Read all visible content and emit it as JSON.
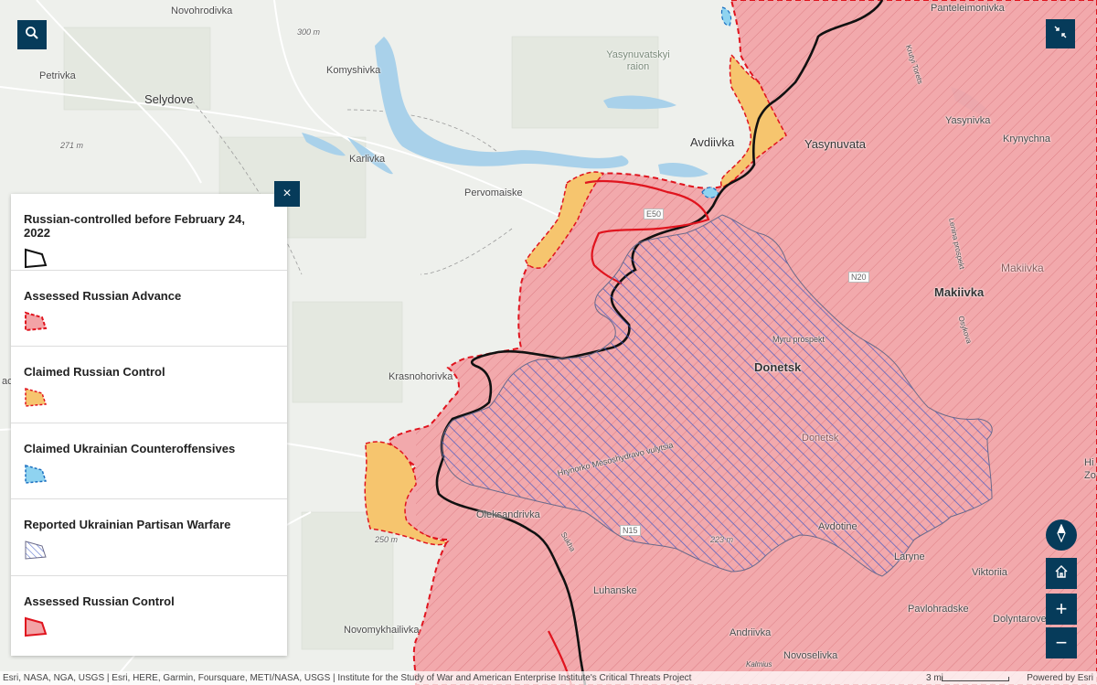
{
  "map": {
    "places": {
      "novohrodivka": "Novohrodivka",
      "petrivka": "Petrivka",
      "selydove": "Selydove",
      "komyshivka": "Komyshivka",
      "yasynuvatskyi_raion": "Yasynuvatskyi raion",
      "avdiivka": "Avdiivka",
      "karlivka": "Karlivka",
      "pervomaiske": "Pervomaiske",
      "panteleimonivka": "Panteleimonivka",
      "yasynivka": "Yasynivka",
      "yasynuvata": "Yasynuvata",
      "krynychna": "Krynychna",
      "makiivka_big": "Makiivka",
      "makiivka_small": "Makiivka",
      "donetsk": "Donetsk",
      "donetsk_small": "Donetsk",
      "krasnohorivka": "Krasnohorivka",
      "oleksandrivka": "Oleksandrivka",
      "avdotine": "Avdotine",
      "laryne": "Laryne",
      "viktoriia": "Viktoriia",
      "luhanske": "Luhanske",
      "pavlohradske": "Pavlohradske",
      "andriivka": "Andriivka",
      "dolyntarove": "Dolyntarove",
      "novomykhailivka": "Novomykhailivka",
      "novoselivka": "Novoselivka",
      "myru_prospekt": "Myru prospekt",
      "hrynorko": "Hrynorko Mesoshydravo vulytsia",
      "lenina": "Lenina prospekt",
      "krutyi": "Krutyi Torets",
      "kalmius": "Kalmius",
      "osykova": "Osykova",
      "sukha": "Sukha"
    },
    "elevations": {
      "e300": "300 m",
      "e271": "271 m",
      "e250": "250 m",
      "e223": "223 m"
    },
    "roads": {
      "e50": "E50",
      "n20": "N20",
      "n15": "N15"
    },
    "edge_labels": {
      "zo": "Zo",
      "hi": "Hi",
      "ach": "ach"
    }
  },
  "controls": {
    "search_icon": "search-icon",
    "collapse_icon": "collapse-icon",
    "close_glyph": "×",
    "compass_icon": "compass-icon",
    "home_icon": "home-icon",
    "zoom_in_glyph": "+",
    "zoom_out_glyph": "−"
  },
  "legend": {
    "items": [
      {
        "label": "Russian-controlled before February 24, 2022",
        "symbol": "black-outline"
      },
      {
        "label": "Assessed Russian Advance",
        "symbol": "red-dashed"
      },
      {
        "label": "Claimed Russian Control",
        "symbol": "orange-dashed"
      },
      {
        "label": "Claimed Ukrainian Counteroffensives",
        "symbol": "blue-dashed"
      },
      {
        "label": "Reported Ukrainian Partisan Warfare",
        "symbol": "blue-hatch"
      },
      {
        "label": "Assessed Russian Control",
        "symbol": "red-solid"
      }
    ]
  },
  "attribution": {
    "sources": "Esri, NASA, NGA, USGS | Esri, HERE, Garmin, Foursquare, METI/NASA, USGS | Institute for the Study of War and American Enterprise Institute's Critical Threats Project",
    "scale_label": "3 mi",
    "powered": "Powered by Esri"
  },
  "colors": {
    "russian_control_fill": "#f2a3a6",
    "russian_control_stroke": "#e0141e",
    "claimed_fill": "#f6c56e",
    "counteroffensive_fill": "#8fd3f0",
    "partisan_hatch": "#3a56c6",
    "pre2022_line": "#111111",
    "button_bg": "#063b5a",
    "water": "#a9d1ea",
    "base": "#eef0ec"
  }
}
